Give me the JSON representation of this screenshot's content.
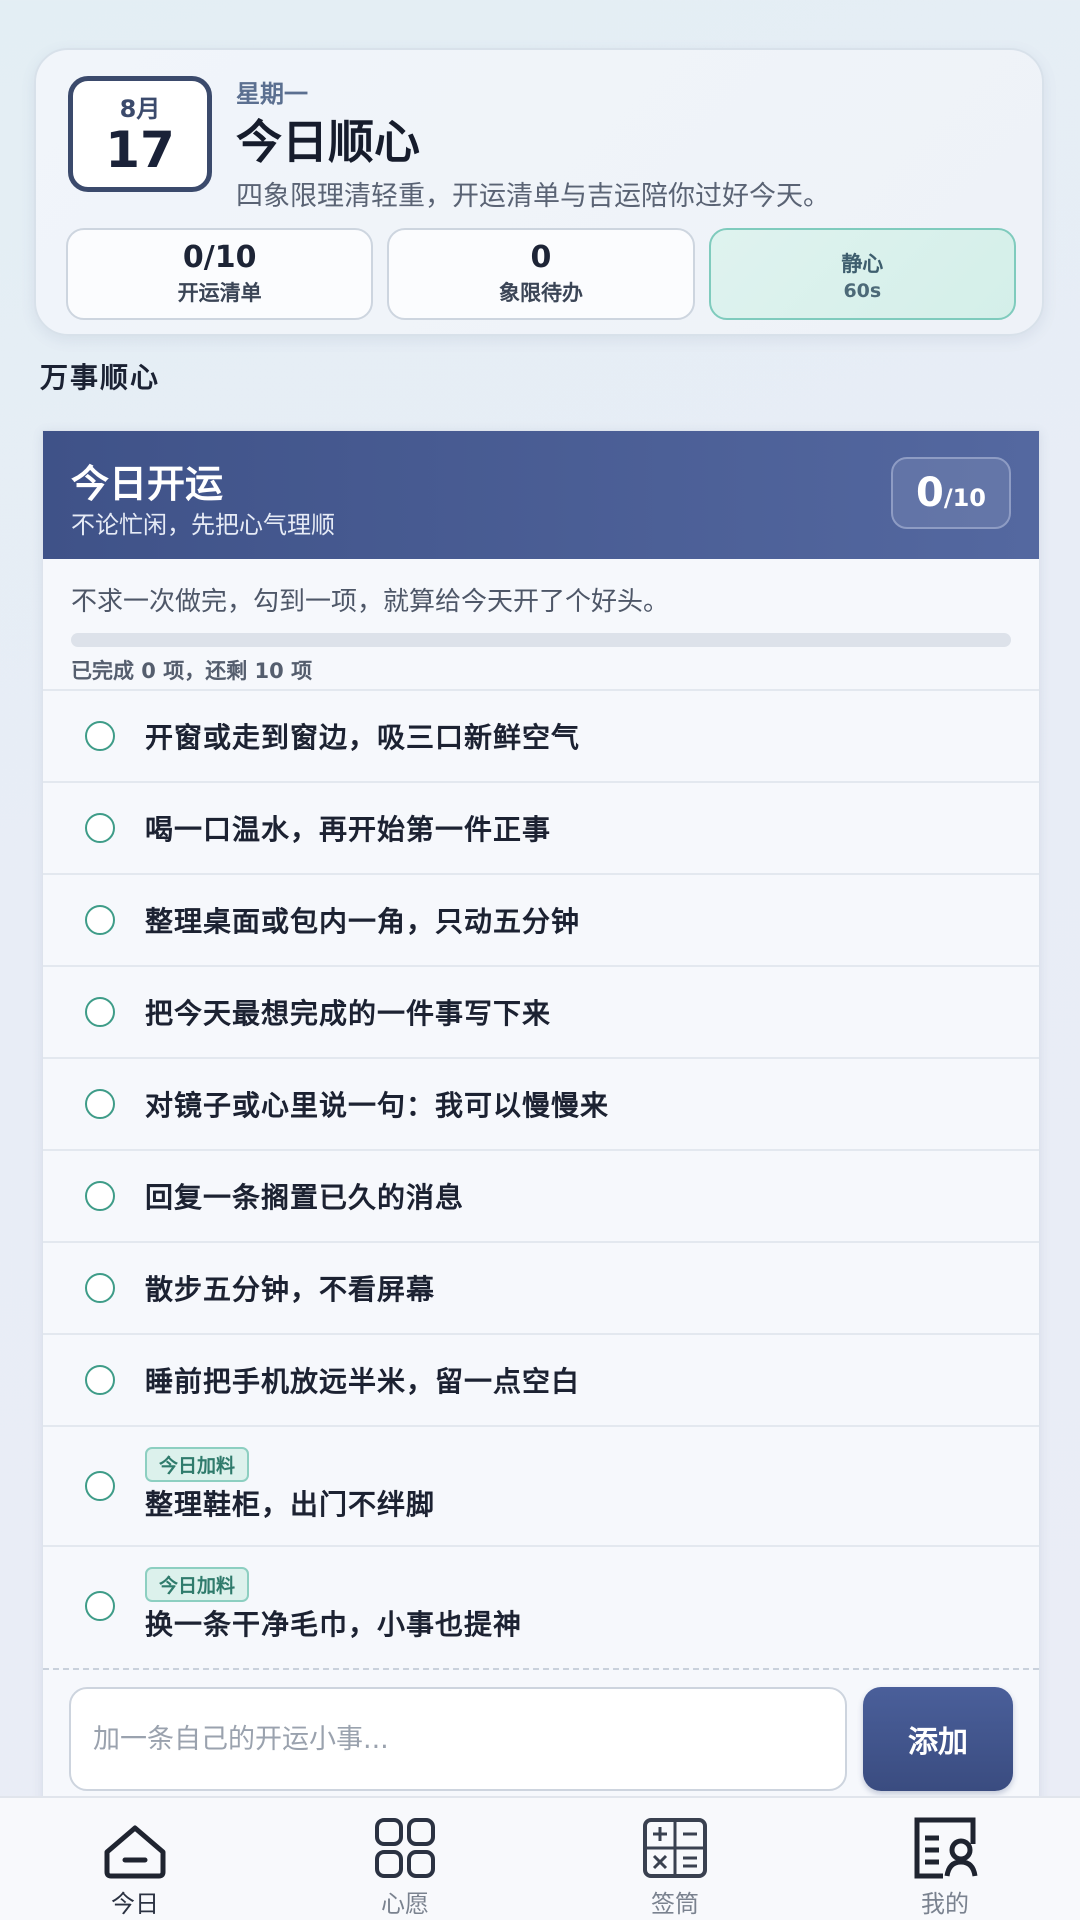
{
  "header": {
    "month": "8月",
    "day": "17",
    "weekday": "星期一",
    "title": "今日顺心",
    "subtitle": "四象限理清轻重，开运清单与吉运陪你过好今天。",
    "stats": [
      {
        "value": "0/10",
        "label": "开运清单"
      },
      {
        "value": "0",
        "label": "象限待办"
      }
    ],
    "calm": {
      "label": "静心",
      "duration": "60s"
    }
  },
  "section_title": "万事顺心",
  "fortune": {
    "title": "今日开运",
    "subtitle": "不论忙闲，先把心气理顺",
    "done": "0",
    "total": "/10",
    "motto": "不求一次做完，勾到一项，就算给今天开了个好头。",
    "progress_percent": 0,
    "progress_text": "已完成 0 项，还剩 10 项",
    "tasks": [
      {
        "label": "开窗或走到窗边，吸三口新鲜空气",
        "done": false
      },
      {
        "label": "喝一口温水，再开始第一件正事",
        "done": false
      },
      {
        "label": "整理桌面或包内一角，只动五分钟",
        "done": false
      },
      {
        "label": "把今天最想完成的一件事写下来",
        "done": false
      },
      {
        "label": "对镜子或心里说一句：我可以慢慢来",
        "done": false
      },
      {
        "label": "回复一条搁置已久的消息",
        "done": false
      },
      {
        "label": "散步五分钟，不看屏幕",
        "done": false
      },
      {
        "label": "睡前把手机放远半米，留一点空白",
        "done": false
      },
      {
        "label": "整理鞋柜，出门不绊脚",
        "tag": "今日加料",
        "done": false
      },
      {
        "label": "换一条干净毛巾，小事也提神",
        "tag": "今日加料",
        "done": false
      }
    ],
    "add_placeholder": "加一条自己的开运小事...",
    "add_value": "",
    "add_button": "添加"
  },
  "nav": [
    {
      "label": "今日",
      "icon": "home-icon",
      "active": true
    },
    {
      "label": "心愿",
      "icon": "grid-icon",
      "active": false
    },
    {
      "label": "签筒",
      "icon": "calculator-icon",
      "active": false
    },
    {
      "label": "我的",
      "icon": "profile-card-icon",
      "active": false
    }
  ],
  "colors": {
    "banner": "#3f5288",
    "accent_teal": "#3e9c88",
    "button": "#3a4c80"
  }
}
